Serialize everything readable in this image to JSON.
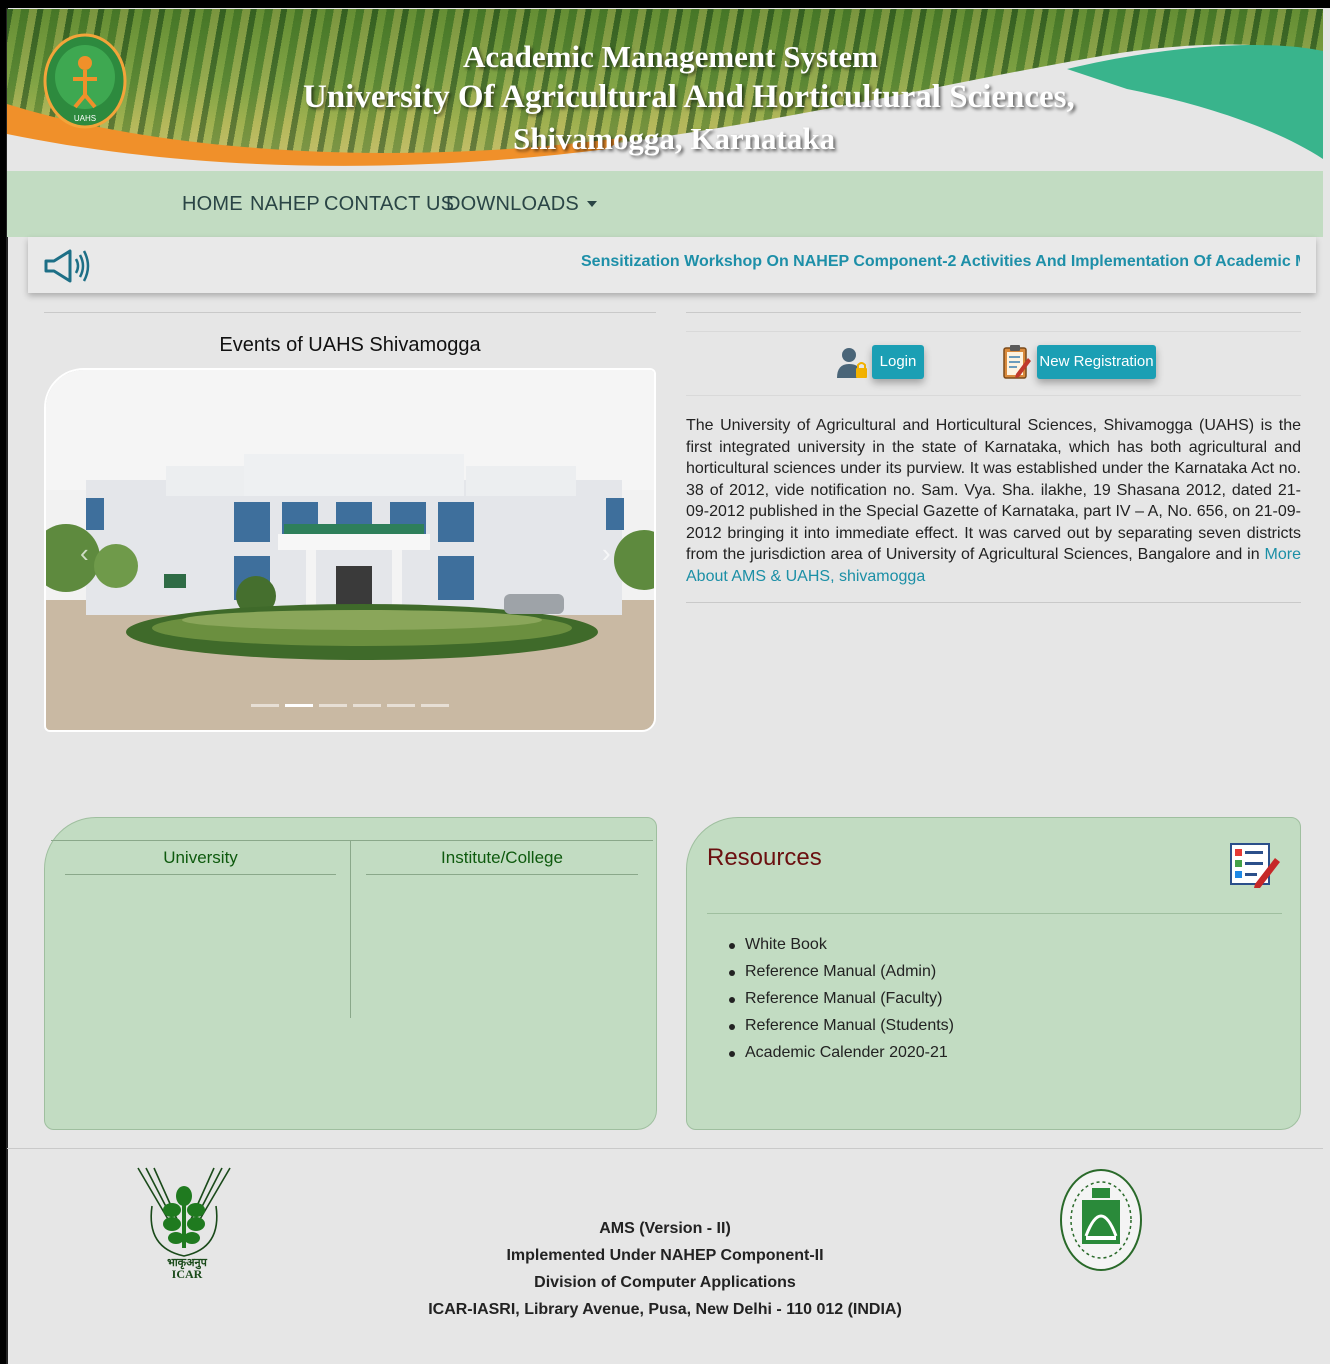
{
  "header": {
    "title_line1": "Academic Management System",
    "title_line2": "University Of Agricultural And Horticultural Sciences,",
    "title_line3": "Shivamogga, Karnataka",
    "logo_text": "UAHS"
  },
  "nav": {
    "items": [
      "HOME",
      "NAHEP",
      "CONTACT US",
      "DOWNLOADS"
    ]
  },
  "news": {
    "icon": "megaphone-icon",
    "text": "Sensitization Workshop On NAHEP Component-2 Activities And Implementation Of Academic Management System"
  },
  "events": {
    "title": "Events of UAHS Shivamogga",
    "slide_count": 6,
    "active_slide": 2
  },
  "auth": {
    "login_label": "Login",
    "register_label": "New Registration"
  },
  "about": {
    "text": "The University of Agricultural and Horticultural Sciences, Shivamogga (UAHS) is the first integrated university in the state of Karnataka, which has both agricultural and horticultural sciences under its purview. It was established under the Karnataka Act no. 38 of 2012, vide notification no. Sam. Vya. Sha. ilakhe, 19 Shasana 2012, dated 21-09-2012 published in the Special Gazette of Karnataka, part IV – A, No. 656, on 21-09-2012 bringing it into immediate effect. It was carved out by separating seven districts from the jurisdiction area of University of Agricultural Sciences, Bangalore and in ",
    "link": "More About AMS & UAHS, shivamogga"
  },
  "university_panel": {
    "col1": "University",
    "col2": "Institute/College"
  },
  "resources": {
    "title": "Resources",
    "items": [
      "White Book",
      "Reference Manual (Admin)",
      "Reference Manual (Faculty)",
      "Reference Manual (Students)",
      "Academic Calender 2020-21"
    ]
  },
  "footer": {
    "line1": "AMS (Version - II)",
    "line2": "Implemented Under NAHEP Component-II",
    "line3": "Division of Computer Applications",
    "line4": "ICAR-IASRI, Library Avenue, Pusa, New Delhi - 110 012 (INDIA)",
    "icar_text": "ICAR",
    "icar_hindi": "भाकृअनुप"
  },
  "colors": {
    "nav_bg": "#c2dcc2",
    "accent": "#1b9fb4",
    "news_text": "#1d8fa8",
    "resources_title": "#6b1010",
    "panel_bg": "#c2dcc2"
  }
}
